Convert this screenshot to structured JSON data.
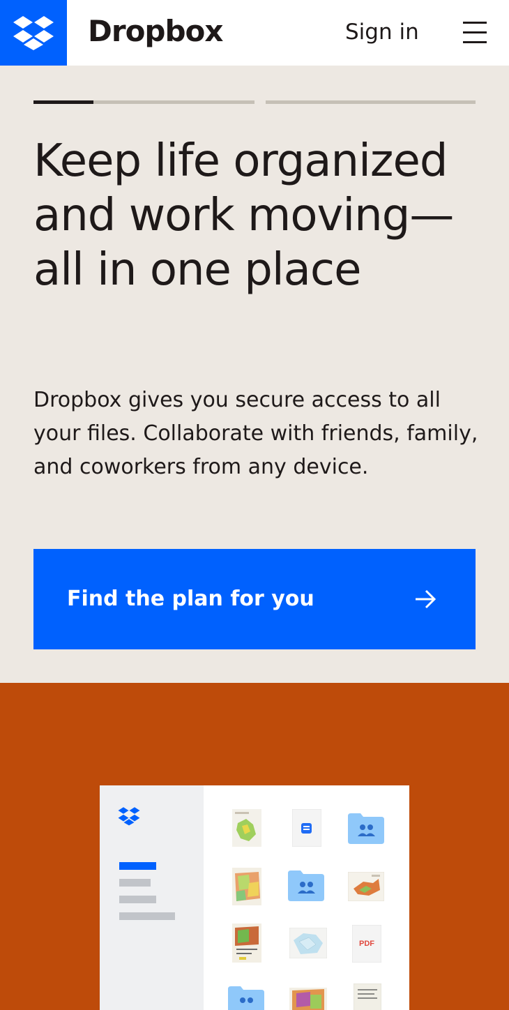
{
  "header": {
    "brand": "Dropbox",
    "signin_label": "Sign in",
    "menu_icon": "hamburger-menu-icon",
    "logo_icon": "dropbox-logo-icon"
  },
  "hero": {
    "carousel_progress": [
      0.27,
      0
    ],
    "headline": "Keep life organized and work moving—all in one place",
    "description": "Dropbox gives you secure access to all your files. Collaborate with friends, family, and coworkers from any device.",
    "cta_label": "Find the plan for you",
    "cta_icon": "arrow-right-icon"
  },
  "illustration": {
    "files": [
      {
        "type": "map-thumbnail"
      },
      {
        "type": "document"
      },
      {
        "type": "shared-folder"
      },
      {
        "type": "map-thumbnail"
      },
      {
        "type": "shared-folder"
      },
      {
        "type": "map-thumbnail"
      },
      {
        "type": "map-thumbnail"
      },
      {
        "type": "map-thumbnail"
      },
      {
        "type": "pdf",
        "label": "PDF"
      },
      {
        "type": "shared-folder"
      },
      {
        "type": "map-thumbnail"
      },
      {
        "type": "document-scan"
      }
    ]
  },
  "colors": {
    "brand_blue": "#0061fe",
    "hero_bg": "#ede8e2",
    "band_orange": "#be4b0a",
    "text": "#1e1919",
    "folder_blue": "#8fc8fa"
  }
}
